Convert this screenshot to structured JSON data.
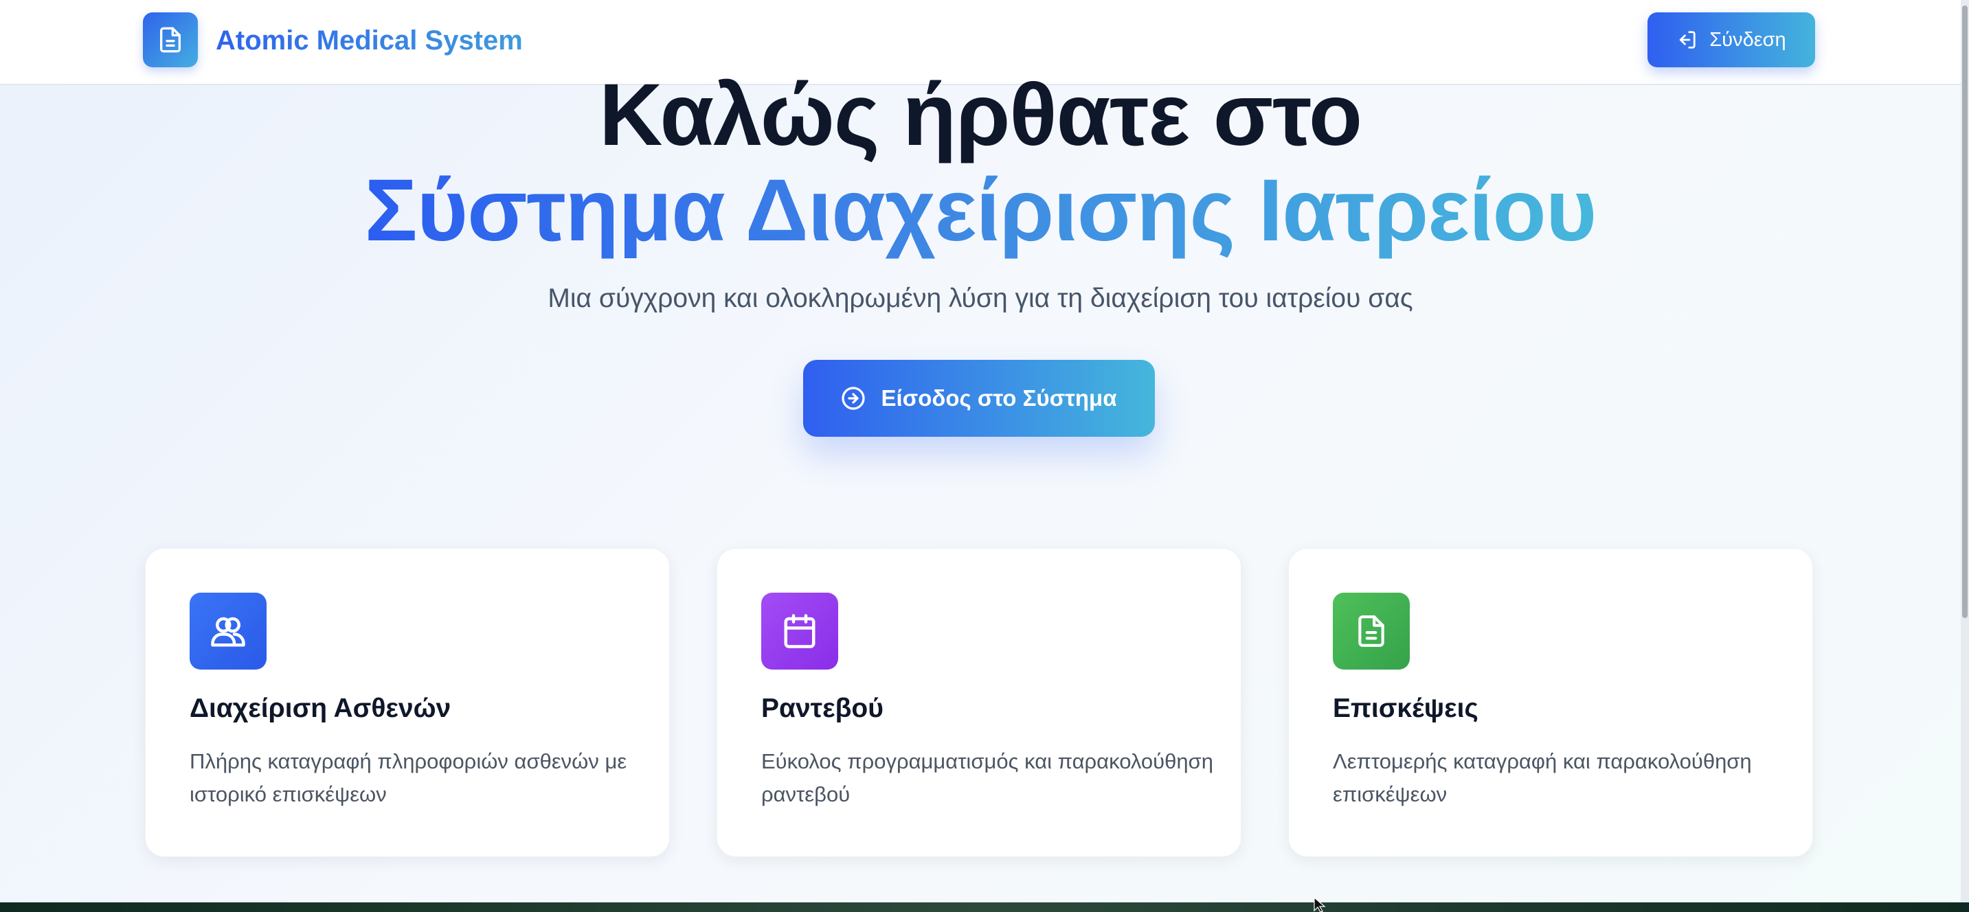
{
  "header": {
    "brand_name": "Atomic Medical System",
    "brand_icon": "document-icon",
    "login_label": "Σύνδεση",
    "login_icon": "log-in-icon"
  },
  "hero": {
    "title_line1": "Καλώς ήρθατε στο",
    "title_line2": "Σύστημα Διαχείρισης Ιατρείου",
    "subtitle": "Μια σύγχρονη και ολοκληρωμένη λύση για τη διαχείριση του ιατρείου σας",
    "cta_label": "Είσοδος στο Σύστημα",
    "cta_icon": "arrow-right-circle-icon"
  },
  "features": [
    {
      "icon": "users-icon",
      "title": "Διαχείριση Ασθενών",
      "description": "Πλήρης καταγραφή πληροφοριών ασθενών με ιστορικό επισκέψεων"
    },
    {
      "icon": "calendar-icon",
      "title": "Ραντεβού",
      "description": "Εύκολος προγραμματισμός και παρακολούθηση ραντεβού"
    },
    {
      "icon": "document-icon",
      "title": "Επισκέψεις",
      "description": "Λεπτομερής καταγραφή και παρακολούθηση επισκέψεων"
    }
  ],
  "colors": {
    "accent_blue": "#2f64ec",
    "accent_cyan": "#45b4dc",
    "heading": "#0f172a",
    "body_text": "#475569",
    "feature_blue": "#3366f2",
    "feature_purple": "#9b3ef0",
    "feature_green": "#42b353"
  }
}
